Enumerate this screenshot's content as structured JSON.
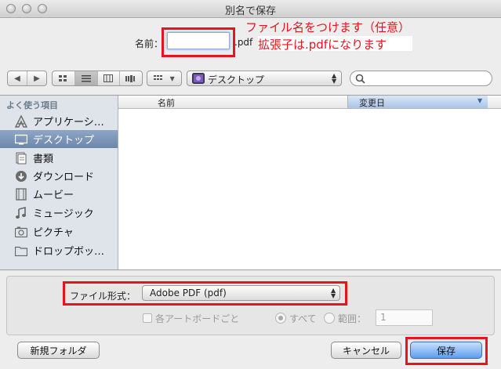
{
  "window": {
    "title": "別名で保存"
  },
  "save_as": {
    "label": "名前：",
    "value": "",
    "extension": ".pdf"
  },
  "annotations": {
    "filename_note": "ファイル名をつけます（任意）",
    "extension_note": "拡張子は.pdfになります"
  },
  "toolbar": {
    "location": "デスクトップ",
    "search_value": ""
  },
  "sidebar": {
    "heading": "よく使う項目",
    "items": [
      {
        "label": "アプリケーシ…",
        "icon": "applications-icon"
      },
      {
        "label": "デスクトップ",
        "icon": "desktop-icon",
        "selected": true
      },
      {
        "label": "書類",
        "icon": "documents-icon"
      },
      {
        "label": "ダウンロード",
        "icon": "downloads-icon"
      },
      {
        "label": "ムービー",
        "icon": "movies-icon"
      },
      {
        "label": "ミュージック",
        "icon": "music-icon"
      },
      {
        "label": "ピクチャ",
        "icon": "pictures-icon"
      },
      {
        "label": "ドロップボッ…",
        "icon": "dropbox-folder-icon"
      }
    ]
  },
  "file_list": {
    "columns": {
      "name": "名前",
      "date_modified": "変更日"
    }
  },
  "options": {
    "format_label": "ファイル形式：",
    "format_value": "Adobe PDF (pdf)",
    "each_artboard": "各アートボードごと",
    "all": "すべて",
    "range": "範囲：",
    "range_value": "1"
  },
  "buttons": {
    "new_folder": "新規フォルダ",
    "cancel": "キャンセル",
    "save": "保存"
  },
  "colors": {
    "highlight": "#e8131b",
    "selection": "#6d87ab",
    "default_button": "#5d9cf0"
  }
}
